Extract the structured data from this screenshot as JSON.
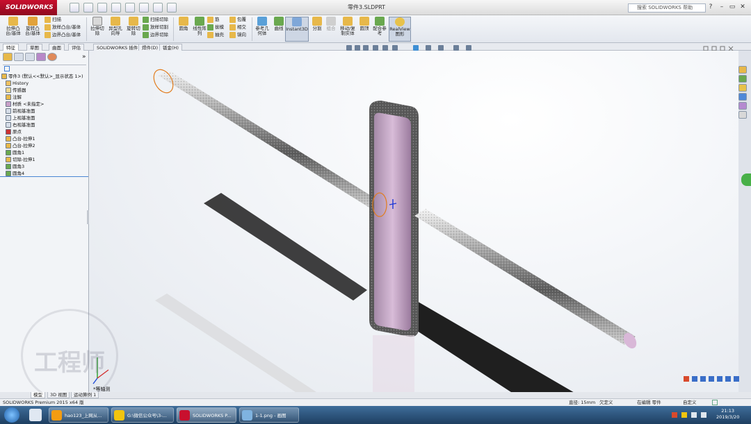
{
  "app": {
    "logo": "SOLIDWORKS",
    "document_title": "零件3.SLDPRT",
    "search_placeholder": "搜索 SOLIDWORKS 帮助"
  },
  "ribbon": {
    "big_buttons": [
      {
        "label": "拉伸凸\n台/基体"
      },
      {
        "label": "旋转凸\n台/基体"
      },
      {
        "label": "拉伸切\n除"
      },
      {
        "label": "异型孔\n向导"
      },
      {
        "label": "旋转切\n除"
      },
      {
        "label": "圆角"
      },
      {
        "label": "线性阵\n列"
      },
      {
        "label": "参考几\n何体"
      },
      {
        "label": "曲线"
      },
      {
        "label": "Instant3D"
      },
      {
        "label": "分割"
      },
      {
        "label": "组合"
      },
      {
        "label": "移动/复\n制实体"
      },
      {
        "label": "圆顶"
      },
      {
        "label": "配合参\n考"
      },
      {
        "label": "RealView\n图形"
      }
    ],
    "small_boss": [
      "扫描",
      "放样凸台/基体",
      "边界凸台/基体"
    ],
    "small_cut": [
      "扫描切除",
      "放样切割",
      "边界切除"
    ],
    "small_features": [
      "筋",
      "拔模",
      "抽壳"
    ],
    "small_features2": [
      "包覆",
      "相交",
      "镜向"
    ]
  },
  "tabs": [
    "特征",
    "草图",
    "曲面",
    "评估",
    "DimXpert",
    "SOLIDWORKS 插件",
    "焊件(D)",
    "钣金(H)"
  ],
  "feature_tree": {
    "root": "零件3 (默认<<默认>_显示状态 1>)",
    "items": [
      "History",
      "传感器",
      "注解",
      "材质 <未指定>",
      "前视基准面",
      "上视基准面",
      "右视基准面",
      "原点",
      "凸台-拉伸1",
      "凸台-拉伸2",
      "圆角1",
      "切除-拉伸1",
      "圆角3",
      "圆角4"
    ]
  },
  "viewport": {
    "view_label": "*等轴测"
  },
  "bottom_tabs": [
    "模型",
    "3D 视图",
    "运动算例 1"
  ],
  "status": {
    "product": "SOLIDWORKS Premium 2015 x64 版",
    "diameter": "直径: 15mm",
    "underdefined": "欠定义",
    "editing": "在编辑 零件",
    "custom": "自定义"
  },
  "taskbar": {
    "items": [
      "hao123_上网从...",
      "G:\\微信公众号\\3-...",
      "SOLIDWORKS P...",
      "1-1.png - 画图"
    ],
    "time": "21:13",
    "date": "2019/3/20"
  },
  "watermark": "工程师",
  "colors": {
    "accent_red": "#c8102e",
    "part_tint": "#c8a0c8",
    "rod_metal": "#8a8a8a"
  }
}
